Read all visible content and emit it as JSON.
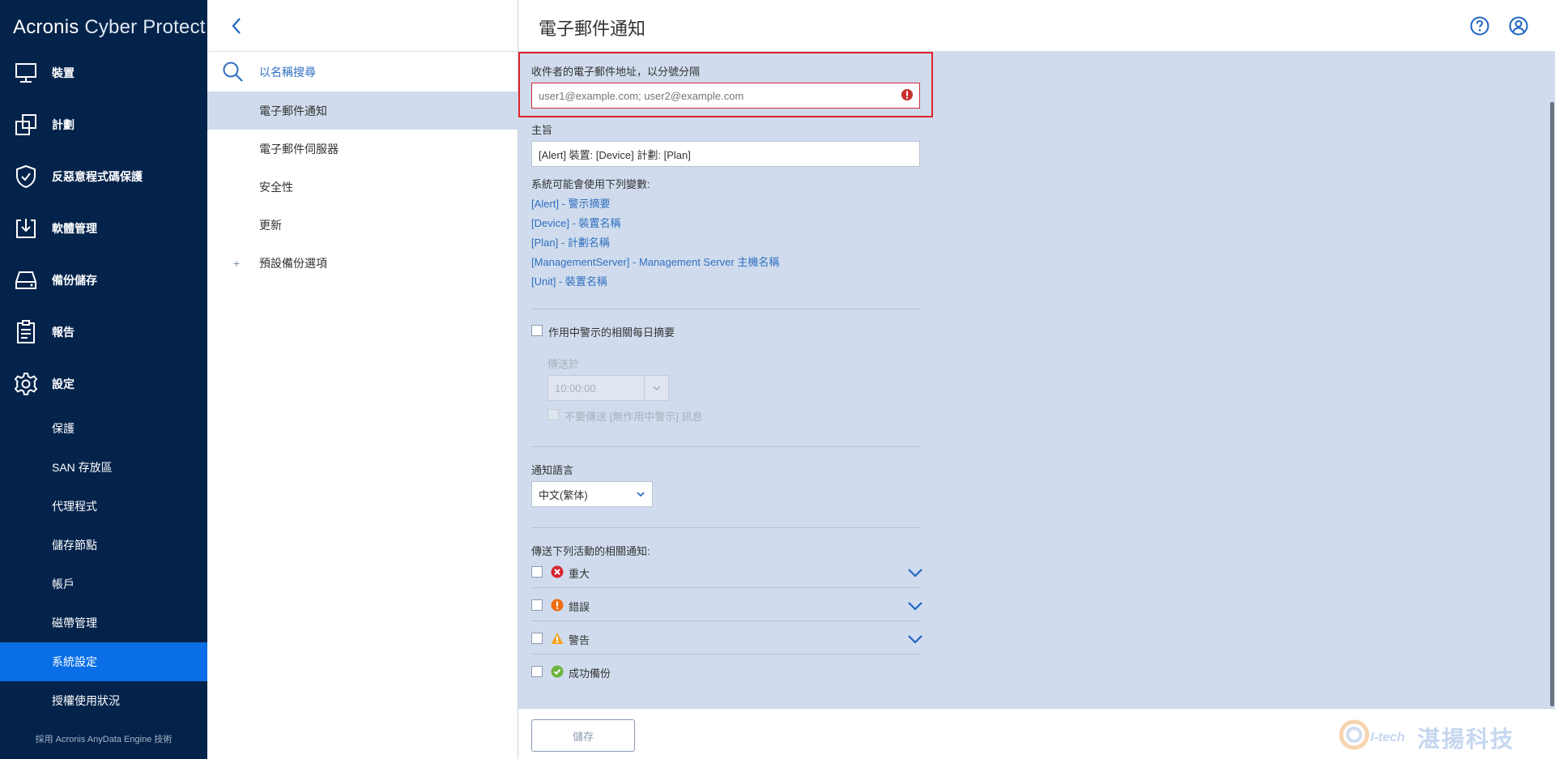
{
  "app": {
    "logo_brand": "Acronis",
    "logo_product": "Cyber Protect",
    "footer_note": "採用 Acronis AnyData Engine 技術"
  },
  "nav": {
    "items": [
      {
        "label": "裝置",
        "icon": "monitor-icon"
      },
      {
        "label": "計劃",
        "icon": "plans-icon"
      },
      {
        "label": "反惡意程式碼保護",
        "icon": "shield-icon"
      },
      {
        "label": "軟體管理",
        "icon": "software-download-icon"
      },
      {
        "label": "備份儲存",
        "icon": "storage-drive-icon"
      },
      {
        "label": "報告",
        "icon": "clipboard-icon"
      },
      {
        "label": "設定",
        "icon": "gear-icon"
      }
    ],
    "sub_items": [
      {
        "label": "保護"
      },
      {
        "label": "SAN 存放區"
      },
      {
        "label": "代理程式"
      },
      {
        "label": "儲存節點"
      },
      {
        "label": "帳戶"
      },
      {
        "label": "磁帶管理"
      },
      {
        "label": "系統設定",
        "active": true
      },
      {
        "label": "授權使用狀況"
      }
    ]
  },
  "middle": {
    "search_placeholder": "以名稱搜尋",
    "items": [
      {
        "label": "電子郵件通知",
        "selected": true
      },
      {
        "label": "電子郵件伺服器"
      },
      {
        "label": "安全性"
      },
      {
        "label": "更新"
      },
      {
        "label": "預設備份選項",
        "expandable": true,
        "expand_symbol": "+"
      }
    ]
  },
  "main": {
    "title": "電子郵件通知",
    "recipients_label": "收件者的電子郵件地址，以分號分隔",
    "recipients_placeholder": "user1@example.com; user2@example.com",
    "subject_label": "主旨",
    "subject_value": "[Alert] 裝置: [Device] 計劃: [Plan]",
    "variables_title": "系統可能會使用下列變數:",
    "variables": [
      "[Alert] - 警示摘要",
      "[Device] - 裝置名稱",
      "[Plan] - 計劃名稱",
      "[ManagementServer] - Management Server 主機名稱",
      "[Unit] - 裝置名稱"
    ],
    "daily_digest_label": "作用中警示的相關每日摘要",
    "send_at_label": "傳送於",
    "send_at_value": "10:00:00",
    "no_alerts_label": "不要傳送 [無作用中警示] 訊息",
    "language_label": "通知語言",
    "language_value": "中文(繁体)",
    "activities_label": "傳送下列活動的相關通知:",
    "severities": [
      {
        "label": "重大",
        "icon": "critical-icon",
        "color": "#d9232f",
        "expandable": true
      },
      {
        "label": "錯誤",
        "icon": "error-icon",
        "color": "#ef6d10",
        "expandable": true
      },
      {
        "label": "警告",
        "icon": "warning-icon",
        "color": "#f5a623",
        "expandable": true
      },
      {
        "label": "成功備份",
        "icon": "success-icon",
        "color": "#6cb33f",
        "expandable": false
      }
    ],
    "save_label": "儲存"
  },
  "watermark": {
    "latin": "I-tech",
    "chinese": "湛揚科技"
  },
  "colors": {
    "nav_bg": "#04234b",
    "nav_active": "#0a6ee6",
    "panel_bg": "#d0dced",
    "link": "#2f6fc0",
    "highlight": "#e0232b"
  }
}
